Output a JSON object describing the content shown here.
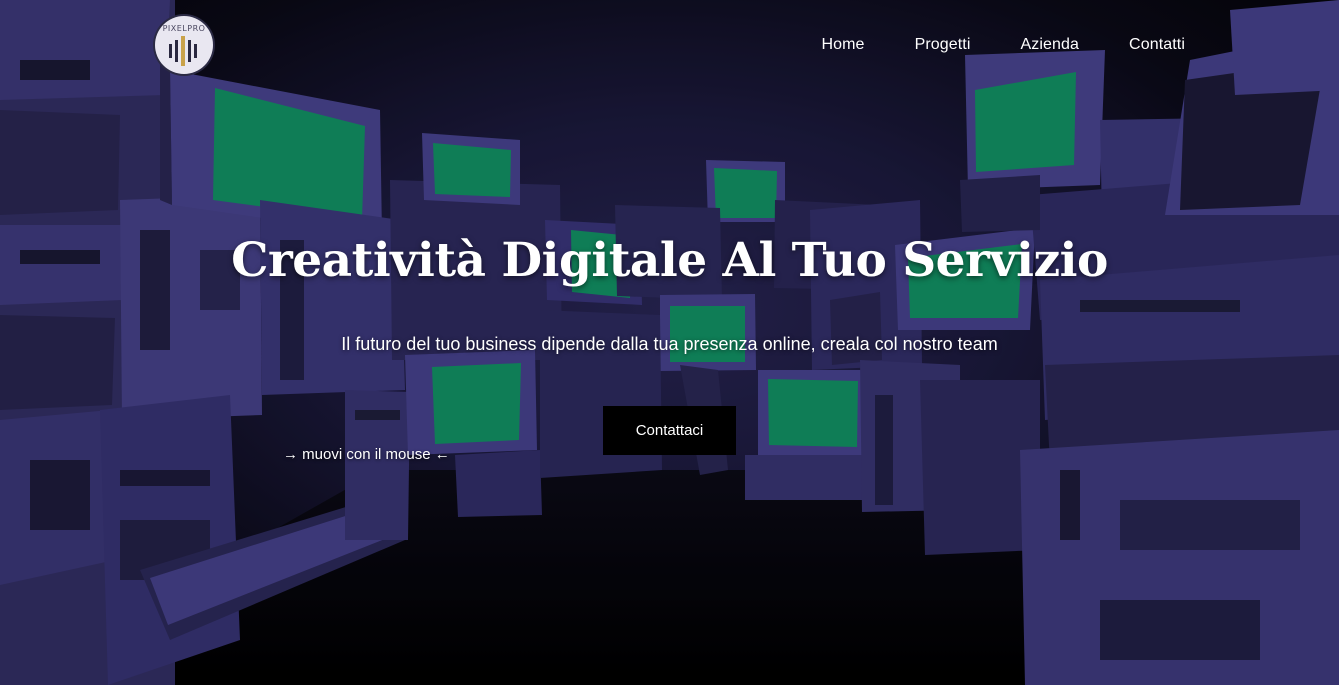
{
  "brand": {
    "logo_text": "PIXELPRO"
  },
  "nav": {
    "items": [
      {
        "label": "Home"
      },
      {
        "label": "Progetti"
      },
      {
        "label": "Azienda"
      },
      {
        "label": "Contatti"
      }
    ]
  },
  "hero": {
    "title": "Creatività Digitale Al Tuo Servizio",
    "subtitle": "Il futuro del tuo business dipende dalla tua presenza online, creala col nostro team",
    "cta_label": "Contattaci",
    "hint": "→ muovi con il mouse ←"
  },
  "colors": {
    "screen_green": "#13996a",
    "machine_purple": "#3b3778",
    "background": "#050507"
  }
}
